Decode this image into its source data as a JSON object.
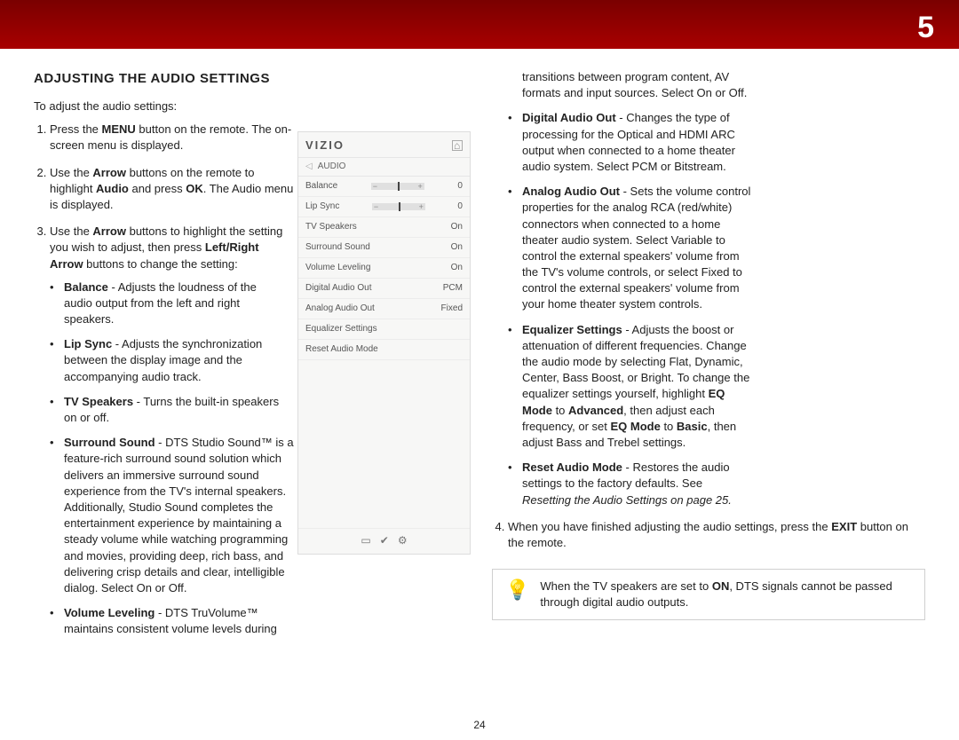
{
  "chapter": "5",
  "pageNumber": "24",
  "heading": "ADJUSTING THE AUDIO SETTINGS",
  "intro": "To adjust the audio settings:",
  "steps": {
    "s1_pre": "Press the ",
    "s1_b1": "MENU",
    "s1_post": " button on the remote. The on-screen menu is displayed.",
    "s2_a": "Use the ",
    "s2_b1": "Arrow",
    "s2_b": " buttons on the remote to highlight ",
    "s2_b2": "Audio",
    "s2_c": " and press ",
    "s2_b3": "OK",
    "s2_d": ". The Audio menu is displayed.",
    "s3_a": "Use the ",
    "s3_b1": "Arrow",
    "s3_b": " buttons to highlight the setting you wish to adjust, then press ",
    "s3_b2": "Left/Right Arrow",
    "s3_c": " buttons to change the setting:",
    "s4_a": "When you have finished adjusting the audio settings, press the ",
    "s4_b1": "EXIT",
    "s4_b": " button on the remote."
  },
  "bullets_left": {
    "balance_t": "Balance",
    "balance": " - Adjusts the loudness of the audio output from the left and right speakers.",
    "lip_t": "Lip Sync",
    "lip": " - Adjusts the synchronization between the display image and the accompanying audio track.",
    "tvsp_t": "TV Speakers",
    "tvsp": " - Turns the built-in speakers on or off.",
    "ss_t": "Surround Sound",
    "ss": " - DTS Studio Sound™ is a feature-rich surround sound solution which delivers an immersive surround sound experience from the TV's internal speakers. Additionally, Studio Sound completes the entertainment experience by maintaining a steady volume while watching programming and movies, providing deep, rich bass, and delivering crisp details and clear, intelligible dialog. Select On or Off.",
    "vl_t": "Volume Leveling",
    "vl": " - DTS TruVolume™ maintains consistent volume levels during transitions between program "
  },
  "right_col": {
    "cont": "content, AV formats and input sources. Select On or Off.",
    "dao_t": "Digital Audio Out",
    "dao": " - Changes the type of processing for the Optical and HDMI ARC output when connected to a home theater audio system. Select PCM or Bitstream.",
    "aao_t": "Analog Audio Out",
    "aao": " - Sets the volume control properties for the analog RCA (red/white) connectors when connected to a home theater audio system. Select Variable to control the external speakers' volume from the TV's volume controls, or select Fixed to control the external speakers' volume from your home theater system controls.",
    "eq_t": "Equalizer Settings",
    "eq_a": " - Adjusts the boost or attenuation of different frequencies. Change the audio mode by selecting Flat, Dynamic, Center, Bass Boost, or Bright. To change the equalizer settings yourself, highlight ",
    "eq_b1": "EQ Mode",
    "eq_b": " to ",
    "eq_b2": "Advanced",
    "eq_c": ", then adjust each frequency, or set ",
    "eq_b3": "EQ Mode",
    "eq_d": " to ",
    "eq_b4": "Basic",
    "eq_e": ", then adjust Bass and Trebel settings.",
    "ram_t": "Reset Audio Mode",
    "ram_a": " - Restores the audio settings to the factory defaults. See ",
    "ram_i": "Resetting the Audio Settings on page 25."
  },
  "menu": {
    "brand": "VIZIO",
    "section": "AUDIO",
    "rows": [
      {
        "label": "Balance",
        "value": "0",
        "slider": true
      },
      {
        "label": "Lip Sync",
        "value": "0",
        "slider": true
      },
      {
        "label": "TV Speakers",
        "value": "On"
      },
      {
        "label": "Surround Sound",
        "value": "On"
      },
      {
        "label": "Volume Leveling",
        "value": "On"
      },
      {
        "label": "Digital Audio Out",
        "value": "PCM"
      },
      {
        "label": "Analog Audio Out",
        "value": "Fixed"
      },
      {
        "label": "Equalizer Settings",
        "value": ""
      },
      {
        "label": "Reset Audio Mode",
        "value": ""
      }
    ]
  },
  "note": {
    "a": "When the TV speakers are set to ",
    "b": "ON",
    "c": ", DTS signals cannot be passed through digital audio outputs."
  }
}
